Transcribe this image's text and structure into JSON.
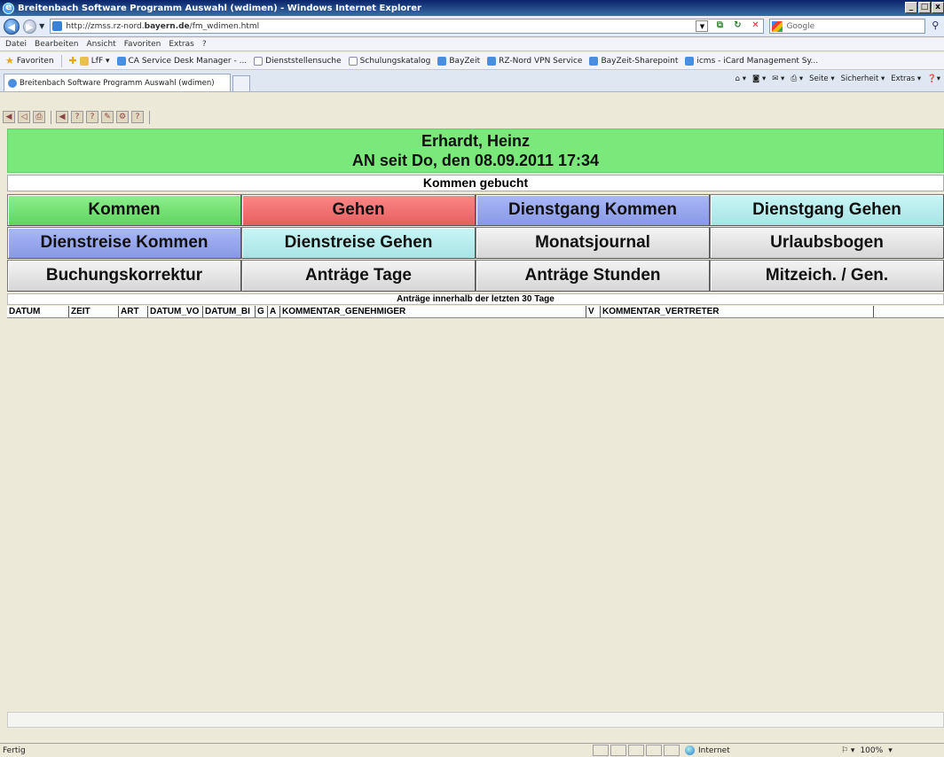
{
  "window": {
    "title": "Breitenbach Software Programm Auswahl (wdimen) - Windows Internet Explorer",
    "buttons": [
      "_",
      "□",
      "x"
    ]
  },
  "address": {
    "url_prefix": "http://zmss.rz-nord.",
    "url_domain": "bayern.de",
    "url_path": "/fm_wdimen.html",
    "search_placeholder": "Google"
  },
  "menu": [
    "Datei",
    "Bearbeiten",
    "Ansicht",
    "Favoriten",
    "Extras",
    "?"
  ],
  "favorites": {
    "label": "Favoriten",
    "items": [
      "LfF ▾",
      "CA Service Desk Manager - ...",
      "Dienststellensuche",
      "Schulungskatalog",
      "BayZeit",
      "RZ-Nord VPN Service",
      "BayZeit-Sharepoint",
      "icms - iCard Management Sy..."
    ]
  },
  "tab": {
    "label": "Breitenbach Software Programm Auswahl (wdimen)"
  },
  "commandbar": [
    "Seite ▾",
    "Sicherheit ▾",
    "Extras ▾"
  ],
  "header": {
    "name": "Erhardt, Heinz",
    "since": "AN seit Do, den 08.09.2011 17:34"
  },
  "status_line": "Kommen gebucht",
  "buttons": {
    "kommen": "Kommen",
    "gehen": "Gehen",
    "dienstgang_kommen": "Dienstgang Kommen",
    "dienstgang_gehen": "Dienstgang Gehen",
    "dienstreise_kommen": "Dienstreise Kommen",
    "dienstreise_gehen": "Dienstreise Gehen",
    "monatsjournal": "Monatsjournal",
    "urlaubsbogen": "Urlaubsbogen",
    "buchungskorrektur": "Buchungskorrektur",
    "antraege_tage": "Anträge Tage",
    "antraege_stunden": "Anträge Stunden",
    "mitzeich": "Mitzeich. / Gen."
  },
  "list": {
    "title": "Anträge innerhalb der letzten 30 Tage",
    "columns": [
      "DATUM",
      "ZEIT",
      "ART",
      "DATUM_VO",
      "DATUM_BI",
      "G",
      "A",
      "KOMMENTAR_GENEHMIGER",
      "V",
      "KOMMENTAR_VERTRETER",
      ""
    ]
  },
  "statusbar": {
    "text": "Fertig",
    "zone": "Internet",
    "zoom": "100%"
  },
  "colors": {
    "header_green": "#7be87b",
    "kommen_green": "#5ed45e",
    "gehen_red": "#e45e5e",
    "dienstgang_blue": "#8898e4",
    "cyan": "#a8e4e4",
    "grey": "#d6d6d6"
  }
}
